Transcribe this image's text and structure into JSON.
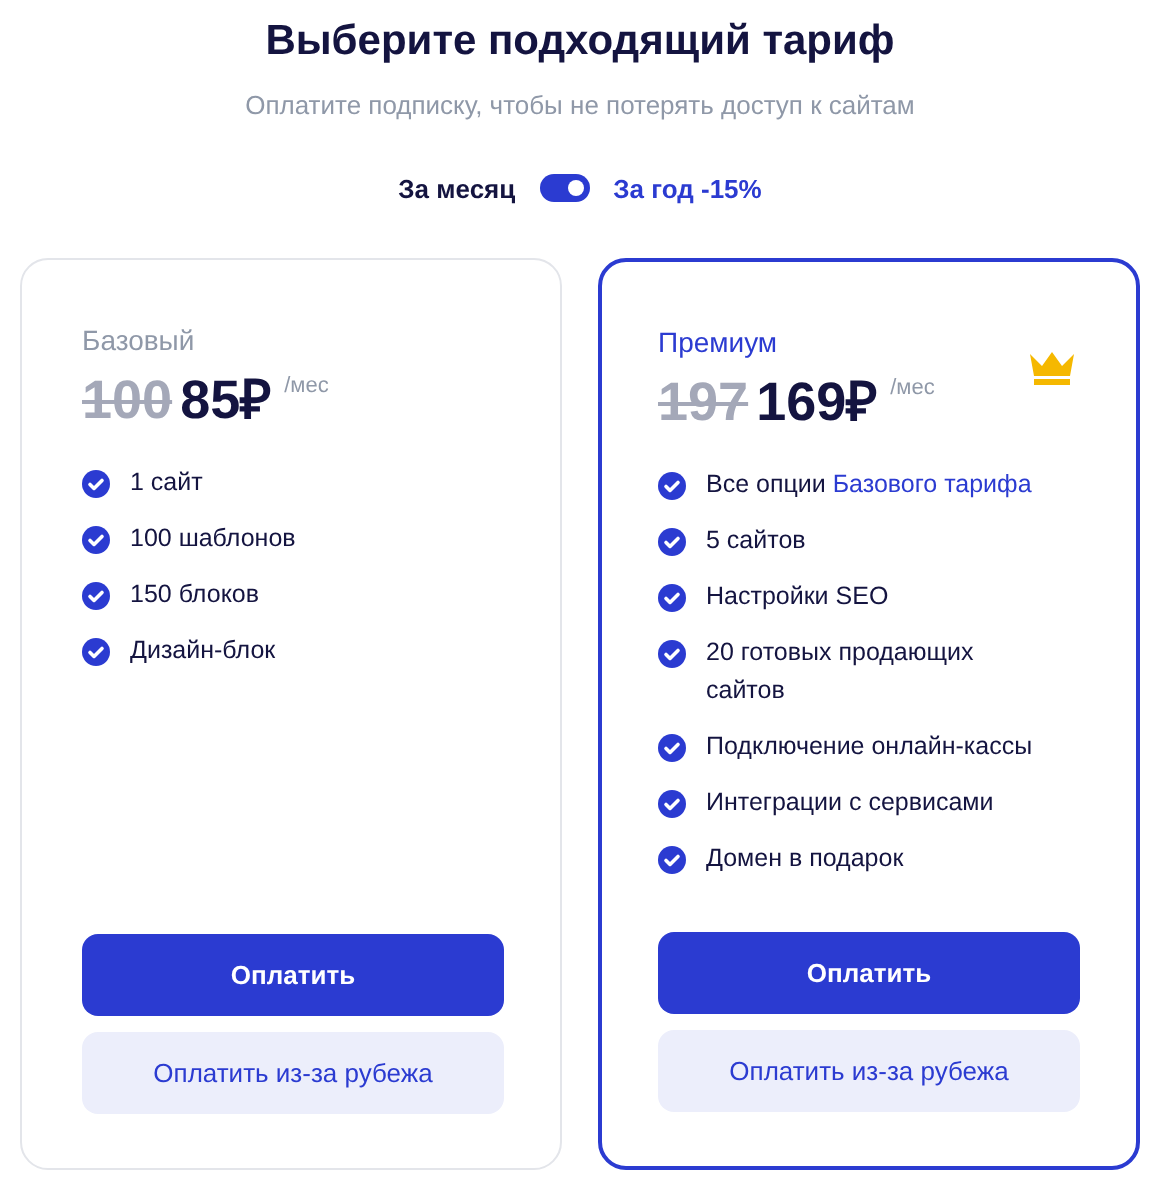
{
  "header": {
    "title": "Выберите подходящий тариф",
    "subtitle": "Оплатите подписку, чтобы не потерять доступ к сайтам"
  },
  "billing": {
    "monthly_label": "За месяц",
    "yearly_label": "За год -15%",
    "yearly": true
  },
  "plans": [
    {
      "name": "Базовый",
      "featured": false,
      "old_price": "100",
      "price": "85₽",
      "period": "/мес",
      "features": [
        {
          "text": "1 сайт"
        },
        {
          "text": "100 шаблонов"
        },
        {
          "text": "150 блоков"
        },
        {
          "text": "Дизайн-блок"
        }
      ],
      "buttons": {
        "primary": "Оплатить",
        "secondary": "Оплатить из-за рубежа"
      }
    },
    {
      "name": "Премиум",
      "featured": true,
      "old_price": "197",
      "price": "169₽",
      "period": "/мес",
      "features": [
        {
          "text": "Все опции ",
          "link": "Базового тарифа"
        },
        {
          "text": "5 сайтов"
        },
        {
          "text": "Настройки SEO"
        },
        {
          "text": "20 готовых продающих сайтов"
        },
        {
          "text": "Подключение онлайн-кассы"
        },
        {
          "text": "Интеграции с сервисами"
        },
        {
          "text": "Домен в подарок"
        }
      ],
      "buttons": {
        "primary": "Оплатить",
        "secondary": "Оплатить из-за рубежа"
      }
    }
  ]
}
